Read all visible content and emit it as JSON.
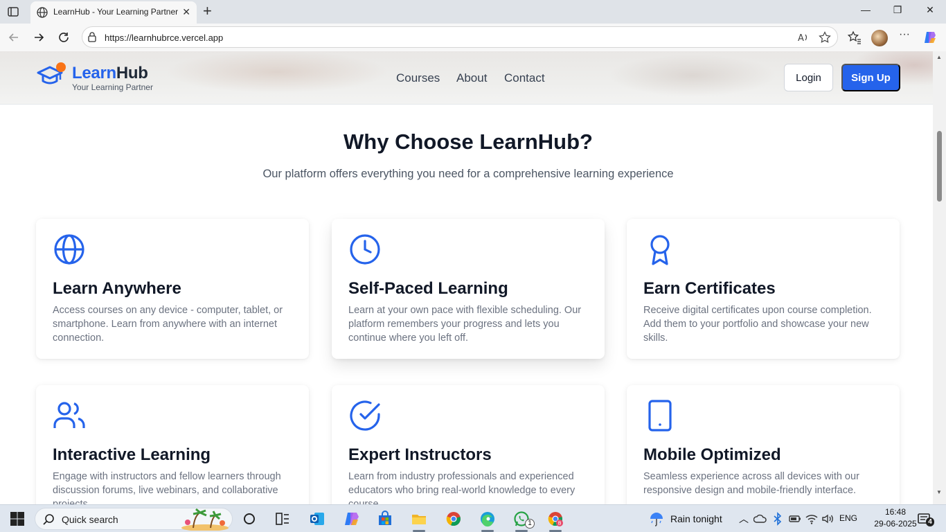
{
  "browser": {
    "tab_title": "LearnHub - Your Learning Partner",
    "url": "https://learnhubrce.vercel.app"
  },
  "header": {
    "logo_learn": "Learn",
    "logo_hub": "Hub",
    "tagline": "Your Learning Partner",
    "nav": [
      "Courses",
      "About",
      "Contact"
    ],
    "login_label": "Login",
    "signup_label": "Sign Up"
  },
  "section": {
    "title": "Why Choose LearnHub?",
    "subtitle": "Our platform offers everything you need for a comprehensive learning experience"
  },
  "features": [
    {
      "icon": "globe-icon",
      "title": "Learn Anywhere",
      "desc": "Access courses on any device - computer, tablet, or smartphone. Learn from anywhere with an internet connection."
    },
    {
      "icon": "clock-icon",
      "title": "Self-Paced Learning",
      "desc": "Learn at your own pace with flexible scheduling. Our platform remembers your progress and lets you continue where you left off."
    },
    {
      "icon": "award-icon",
      "title": "Earn Certificates",
      "desc": "Receive digital certificates upon course completion. Add them to your portfolio and showcase your new skills."
    },
    {
      "icon": "users-icon",
      "title": "Interactive Learning",
      "desc": "Engage with instructors and fellow learners through discussion forums, live webinars, and collaborative projects."
    },
    {
      "icon": "check-circle-icon",
      "title": "Expert Instructors",
      "desc": "Learn from industry professionals and experienced educators who bring real-world knowledge to every course."
    },
    {
      "icon": "smartphone-icon",
      "title": "Mobile Optimized",
      "desc": "Seamless experience across all devices with our responsive design and mobile-friendly interface."
    }
  ],
  "taskbar": {
    "search_placeholder": "Quick search",
    "weather": "Rain tonight",
    "language": "ENG",
    "time": "16:48",
    "date": "29-06-2025",
    "whatsapp_badge": "1",
    "notification_count": "4"
  },
  "colors": {
    "brand_blue": "#2563eb",
    "logo_accent_orange": "#f97316"
  }
}
